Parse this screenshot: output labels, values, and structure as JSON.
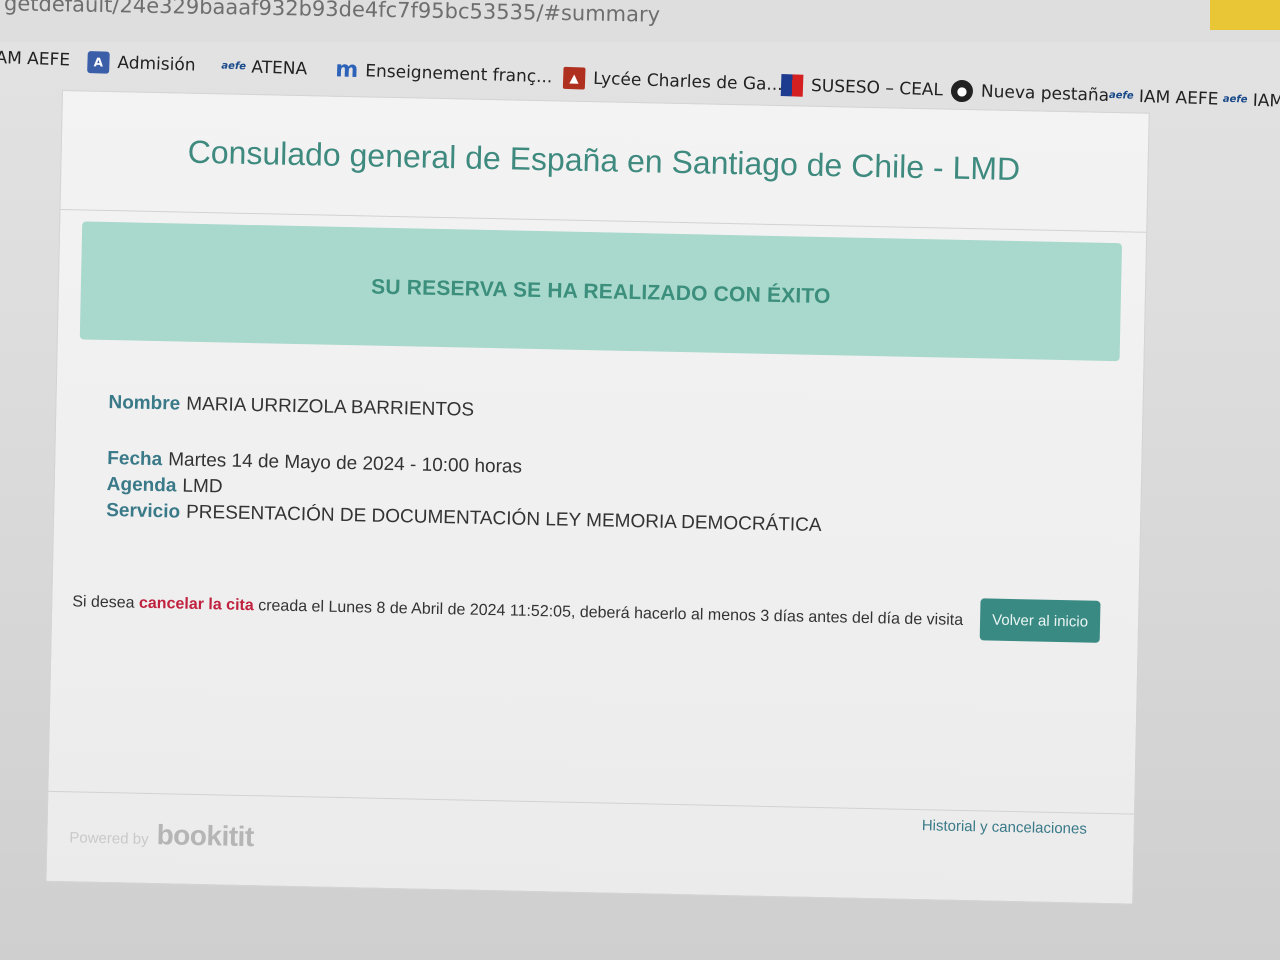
{
  "browser": {
    "url": "getdefault/24e329baaaf932b93de4fc7f95bc53535/#summary",
    "bookmarks": [
      {
        "label": "AM AEFE",
        "icon": "none"
      },
      {
        "label": "Admisión",
        "icon": "admission-icon"
      },
      {
        "label": "ATENA",
        "icon": "aefe-icon"
      },
      {
        "label": "Enseignement franç...",
        "icon": "m-icon"
      },
      {
        "label": "Lycée Charles de Ga...",
        "icon": "lycee-icon"
      },
      {
        "label": "SUSESO – CEAL",
        "icon": "flag-icon"
      },
      {
        "label": "Nueva pestaña",
        "icon": "globe-icon"
      },
      {
        "label": "IAM AEFE",
        "icon": "aefe-icon"
      },
      {
        "label": "IAM",
        "icon": "aefe-icon"
      }
    ],
    "icon_text": {
      "aefe": "aefe",
      "m": "m"
    }
  },
  "page": {
    "title": "Consulado general de España en Santiago de Chile - LMD",
    "success_message": "SU RESERVA SE HA REALIZADO CON ÉXITO",
    "details": {
      "nombre_label": "Nombre",
      "nombre_value": "MARIA URRIZOLA BARRIENTOS",
      "fecha_label": "Fecha",
      "fecha_value": "Martes 14 de Mayo de 2024 - 10:00 horas",
      "agenda_label": "Agenda",
      "agenda_value": "LMD",
      "servicio_label": "Servicio",
      "servicio_value": "PRESENTACIÓN DE DOCUMENTACIÓN LEY MEMORIA DEMOCRÁTICA"
    },
    "cancel": {
      "prefix": "Si desea",
      "link": "cancelar la cita",
      "suffix": "creada el Lunes 8 de Abril de 2024 11:52:05, deberá hacerlo al menos 3 días antes del día de visita"
    },
    "home_button": "Volver al inicio",
    "footer": {
      "powered_by": "Powered by",
      "brand": "bookitit",
      "history_link": "Historial y cancelaciones"
    }
  },
  "colors": {
    "accent": "#3f8a7f",
    "alert_bg": "#a9d8cc",
    "button_bg": "#3a8a84",
    "link_red": "#c0213f"
  }
}
